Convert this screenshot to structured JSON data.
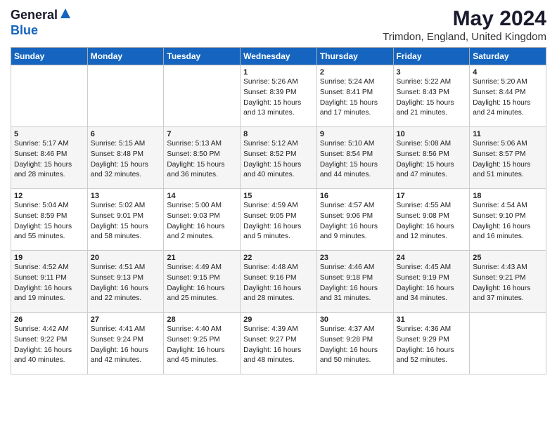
{
  "header": {
    "logo_general": "General",
    "logo_blue": "Blue",
    "month_year": "May 2024",
    "location": "Trimdon, England, United Kingdom"
  },
  "weekdays": [
    "Sunday",
    "Monday",
    "Tuesday",
    "Wednesday",
    "Thursday",
    "Friday",
    "Saturday"
  ],
  "weeks": [
    [
      {
        "day": "",
        "info": ""
      },
      {
        "day": "",
        "info": ""
      },
      {
        "day": "",
        "info": ""
      },
      {
        "day": "1",
        "info": "Sunrise: 5:26 AM\nSunset: 8:39 PM\nDaylight: 15 hours\nand 13 minutes."
      },
      {
        "day": "2",
        "info": "Sunrise: 5:24 AM\nSunset: 8:41 PM\nDaylight: 15 hours\nand 17 minutes."
      },
      {
        "day": "3",
        "info": "Sunrise: 5:22 AM\nSunset: 8:43 PM\nDaylight: 15 hours\nand 21 minutes."
      },
      {
        "day": "4",
        "info": "Sunrise: 5:20 AM\nSunset: 8:44 PM\nDaylight: 15 hours\nand 24 minutes."
      }
    ],
    [
      {
        "day": "5",
        "info": "Sunrise: 5:17 AM\nSunset: 8:46 PM\nDaylight: 15 hours\nand 28 minutes."
      },
      {
        "day": "6",
        "info": "Sunrise: 5:15 AM\nSunset: 8:48 PM\nDaylight: 15 hours\nand 32 minutes."
      },
      {
        "day": "7",
        "info": "Sunrise: 5:13 AM\nSunset: 8:50 PM\nDaylight: 15 hours\nand 36 minutes."
      },
      {
        "day": "8",
        "info": "Sunrise: 5:12 AM\nSunset: 8:52 PM\nDaylight: 15 hours\nand 40 minutes."
      },
      {
        "day": "9",
        "info": "Sunrise: 5:10 AM\nSunset: 8:54 PM\nDaylight: 15 hours\nand 44 minutes."
      },
      {
        "day": "10",
        "info": "Sunrise: 5:08 AM\nSunset: 8:56 PM\nDaylight: 15 hours\nand 47 minutes."
      },
      {
        "day": "11",
        "info": "Sunrise: 5:06 AM\nSunset: 8:57 PM\nDaylight: 15 hours\nand 51 minutes."
      }
    ],
    [
      {
        "day": "12",
        "info": "Sunrise: 5:04 AM\nSunset: 8:59 PM\nDaylight: 15 hours\nand 55 minutes."
      },
      {
        "day": "13",
        "info": "Sunrise: 5:02 AM\nSunset: 9:01 PM\nDaylight: 15 hours\nand 58 minutes."
      },
      {
        "day": "14",
        "info": "Sunrise: 5:00 AM\nSunset: 9:03 PM\nDaylight: 16 hours\nand 2 minutes."
      },
      {
        "day": "15",
        "info": "Sunrise: 4:59 AM\nSunset: 9:05 PM\nDaylight: 16 hours\nand 5 minutes."
      },
      {
        "day": "16",
        "info": "Sunrise: 4:57 AM\nSunset: 9:06 PM\nDaylight: 16 hours\nand 9 minutes."
      },
      {
        "day": "17",
        "info": "Sunrise: 4:55 AM\nSunset: 9:08 PM\nDaylight: 16 hours\nand 12 minutes."
      },
      {
        "day": "18",
        "info": "Sunrise: 4:54 AM\nSunset: 9:10 PM\nDaylight: 16 hours\nand 16 minutes."
      }
    ],
    [
      {
        "day": "19",
        "info": "Sunrise: 4:52 AM\nSunset: 9:11 PM\nDaylight: 16 hours\nand 19 minutes."
      },
      {
        "day": "20",
        "info": "Sunrise: 4:51 AM\nSunset: 9:13 PM\nDaylight: 16 hours\nand 22 minutes."
      },
      {
        "day": "21",
        "info": "Sunrise: 4:49 AM\nSunset: 9:15 PM\nDaylight: 16 hours\nand 25 minutes."
      },
      {
        "day": "22",
        "info": "Sunrise: 4:48 AM\nSunset: 9:16 PM\nDaylight: 16 hours\nand 28 minutes."
      },
      {
        "day": "23",
        "info": "Sunrise: 4:46 AM\nSunset: 9:18 PM\nDaylight: 16 hours\nand 31 minutes."
      },
      {
        "day": "24",
        "info": "Sunrise: 4:45 AM\nSunset: 9:19 PM\nDaylight: 16 hours\nand 34 minutes."
      },
      {
        "day": "25",
        "info": "Sunrise: 4:43 AM\nSunset: 9:21 PM\nDaylight: 16 hours\nand 37 minutes."
      }
    ],
    [
      {
        "day": "26",
        "info": "Sunrise: 4:42 AM\nSunset: 9:22 PM\nDaylight: 16 hours\nand 40 minutes."
      },
      {
        "day": "27",
        "info": "Sunrise: 4:41 AM\nSunset: 9:24 PM\nDaylight: 16 hours\nand 42 minutes."
      },
      {
        "day": "28",
        "info": "Sunrise: 4:40 AM\nSunset: 9:25 PM\nDaylight: 16 hours\nand 45 minutes."
      },
      {
        "day": "29",
        "info": "Sunrise: 4:39 AM\nSunset: 9:27 PM\nDaylight: 16 hours\nand 48 minutes."
      },
      {
        "day": "30",
        "info": "Sunrise: 4:37 AM\nSunset: 9:28 PM\nDaylight: 16 hours\nand 50 minutes."
      },
      {
        "day": "31",
        "info": "Sunrise: 4:36 AM\nSunset: 9:29 PM\nDaylight: 16 hours\nand 52 minutes."
      },
      {
        "day": "",
        "info": ""
      }
    ]
  ]
}
